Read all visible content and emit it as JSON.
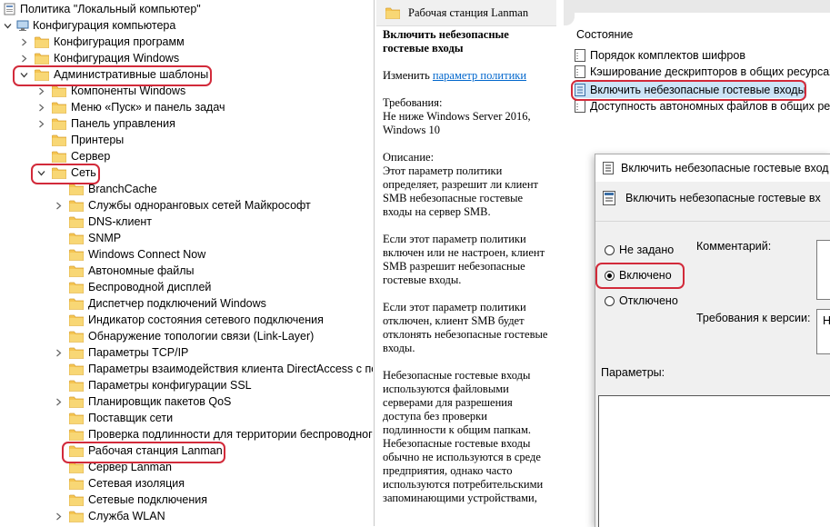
{
  "tree": {
    "root_label": "Политика \"Локальный компьютер\"",
    "items": [
      {
        "label": "Конфигурация компьютера"
      },
      {
        "label": "Конфигурация программ"
      },
      {
        "label": "Конфигурация Windows"
      },
      {
        "label": "Административные шаблоны"
      },
      {
        "label": "Компоненты Windows"
      },
      {
        "label": "Меню «Пуск» и панель задач"
      },
      {
        "label": "Панель управления"
      },
      {
        "label": "Принтеры"
      },
      {
        "label": "Сервер"
      },
      {
        "label": "Сеть"
      },
      {
        "label": "BranchCache"
      },
      {
        "label": "Службы одноранговых сетей Майкрософт"
      },
      {
        "label": "DNS-клиент"
      },
      {
        "label": "SNMP"
      },
      {
        "label": "Windows Connect Now"
      },
      {
        "label": "Автономные файлы"
      },
      {
        "label": "Беспроводной дисплей"
      },
      {
        "label": "Диспетчер подключений Windows"
      },
      {
        "label": "Индикатор состояния сетевого подключения"
      },
      {
        "label": "Обнаружение топологии связи (Link-Layer)"
      },
      {
        "label": "Параметры TCP/IP"
      },
      {
        "label": "Параметры взаимодействия клиента DirectAccess с полы"
      },
      {
        "label": "Параметры конфигурации SSL"
      },
      {
        "label": "Планировщик пакетов QoS"
      },
      {
        "label": "Поставщик сети"
      },
      {
        "label": "Проверка подлинности для территории беспроводного д"
      },
      {
        "label": "Рабочая станция Lanman"
      },
      {
        "label": "Сервер Lanman"
      },
      {
        "label": "Сетевая изоляция"
      },
      {
        "label": "Сетевые подключения"
      },
      {
        "label": "Служба WLAN"
      }
    ]
  },
  "description": {
    "header": "Рабочая станция Lanman",
    "policy_title": "Включить небезопасные гостевые входы",
    "edit_prefix": "Изменить ",
    "edit_link": "параметр политики",
    "requirements_label": "Требования:",
    "requirements_text": "Не ниже Windows Server 2016, Windows 10",
    "description_label": "Описание:",
    "paragraph1": "Этот параметр политики определяет, разрешит ли клиент SMB небезопасные гостевые входы на сервер SMB.",
    "paragraph2": "Если этот параметр политики включен или не настроен, клиент SMB разрешит небезопасные гостевые входы.",
    "paragraph3": "Если этот параметр политики отключен, клиент SMB будет отклонять небезопасные гостевые входы.",
    "paragraph4": "Небезопасные гостевые входы используются файловыми серверами для разрешения доступа без проверки подлинности к общим папкам. Небезопасные гостевые входы обычно не используются в среде предприятия, однако часто используются потребительскими запоминающими устройствами,"
  },
  "settings": {
    "column_header": "Состояние",
    "rows": [
      {
        "label": "Порядок комплектов шифров"
      },
      {
        "label": "Кэширование дескрипторов в общих ресурсах"
      },
      {
        "label": "Включить небезопасные гостевые входы"
      },
      {
        "label": "Доступность автономных файлов в общих рес"
      }
    ]
  },
  "dialog": {
    "title": "Включить небезопасные гостевые вход",
    "inner_title": "Включить небезопасные гостевые вх",
    "radio_not_configured": "Не задано",
    "radio_enabled": "Включено",
    "radio_disabled": "Отключено",
    "selected": "Включено",
    "comment_label": "Комментарий:",
    "supported_label": "Требования к версии:",
    "supported_value_partial": "Н",
    "options_label": "Параметры:"
  },
  "colors": {
    "highlight_outline": "#d22a3a",
    "folder": "#e9b949",
    "link": "#0066cc",
    "selection": "#cce4f7"
  }
}
